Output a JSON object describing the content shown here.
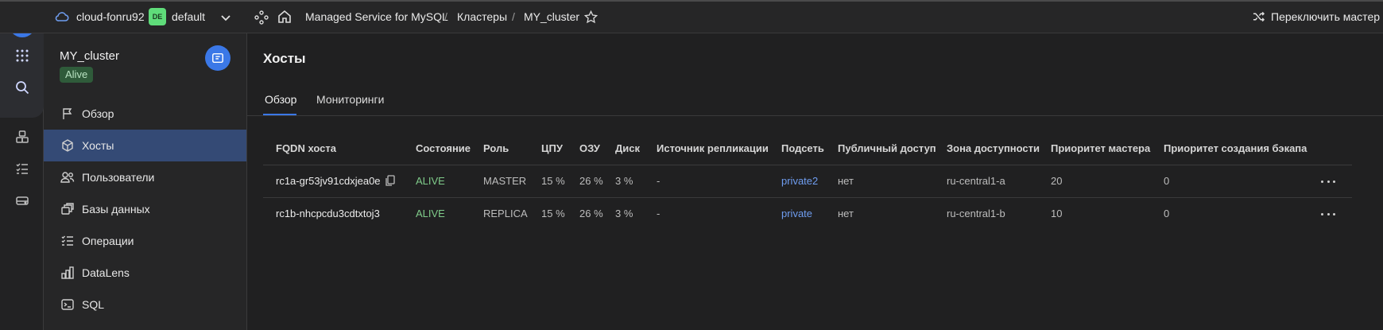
{
  "topbar": {
    "cloud_name": "cloud-fonru92",
    "folder_badge": "DE",
    "folder_name": "default",
    "breadcrumbs": [
      "Managed Service for MySQL",
      "Кластеры",
      "MY_cluster"
    ],
    "separator": "/",
    "wizard_label": "Переключить мастер"
  },
  "sidebar": {
    "cluster_name": "MY_cluster",
    "status": "Alive",
    "items": [
      {
        "label": "Обзор",
        "icon": "flag-icon"
      },
      {
        "label": "Хосты",
        "icon": "cube-icon"
      },
      {
        "label": "Пользователи",
        "icon": "users-icon"
      },
      {
        "label": "Базы данных",
        "icon": "databases-icon"
      },
      {
        "label": "Операции",
        "icon": "operations-icon"
      },
      {
        "label": "DataLens",
        "icon": "chart-icon"
      },
      {
        "label": "SQL",
        "icon": "terminal-icon"
      }
    ],
    "active_index": 1
  },
  "main": {
    "title": "Хосты",
    "tabs": [
      {
        "label": "Обзор",
        "active": true
      },
      {
        "label": "Мониторинги",
        "active": false
      }
    ],
    "table": {
      "columns": [
        "FQDN хоста",
        "Состояние",
        "Роль",
        "ЦПУ",
        "ОЗУ",
        "Диск",
        "Источник репликации",
        "Подсеть",
        "Публичный доступ",
        "Зона доступности",
        "Приоритет мастера",
        "Приоритет создания бэкапа"
      ],
      "rows": [
        {
          "fqdn": "rc1a-gr53jv91cdxjea0e",
          "state": "ALIVE",
          "role": "MASTER",
          "cpu": "15 %",
          "ram": "26 %",
          "disk": "3 %",
          "replication_source": "-",
          "subnet": "private2",
          "public_access": "нет",
          "zone": "ru-central1-a",
          "master_priority": "20",
          "backup_priority": "0"
        },
        {
          "fqdn": "rc1b-nhcpcdu3cdtxtoj3",
          "state": "ALIVE",
          "role": "REPLICA",
          "cpu": "15 %",
          "ram": "26 %",
          "disk": "3 %",
          "replication_source": "-",
          "subnet": "private",
          "public_access": "нет",
          "zone": "ru-central1-b",
          "master_priority": "10",
          "backup_priority": "0"
        }
      ]
    }
  },
  "colors": {
    "accent": "#3b78e7",
    "alive": "#7fcb8a",
    "link": "#6f9df0",
    "active_nav": "#344a75"
  }
}
